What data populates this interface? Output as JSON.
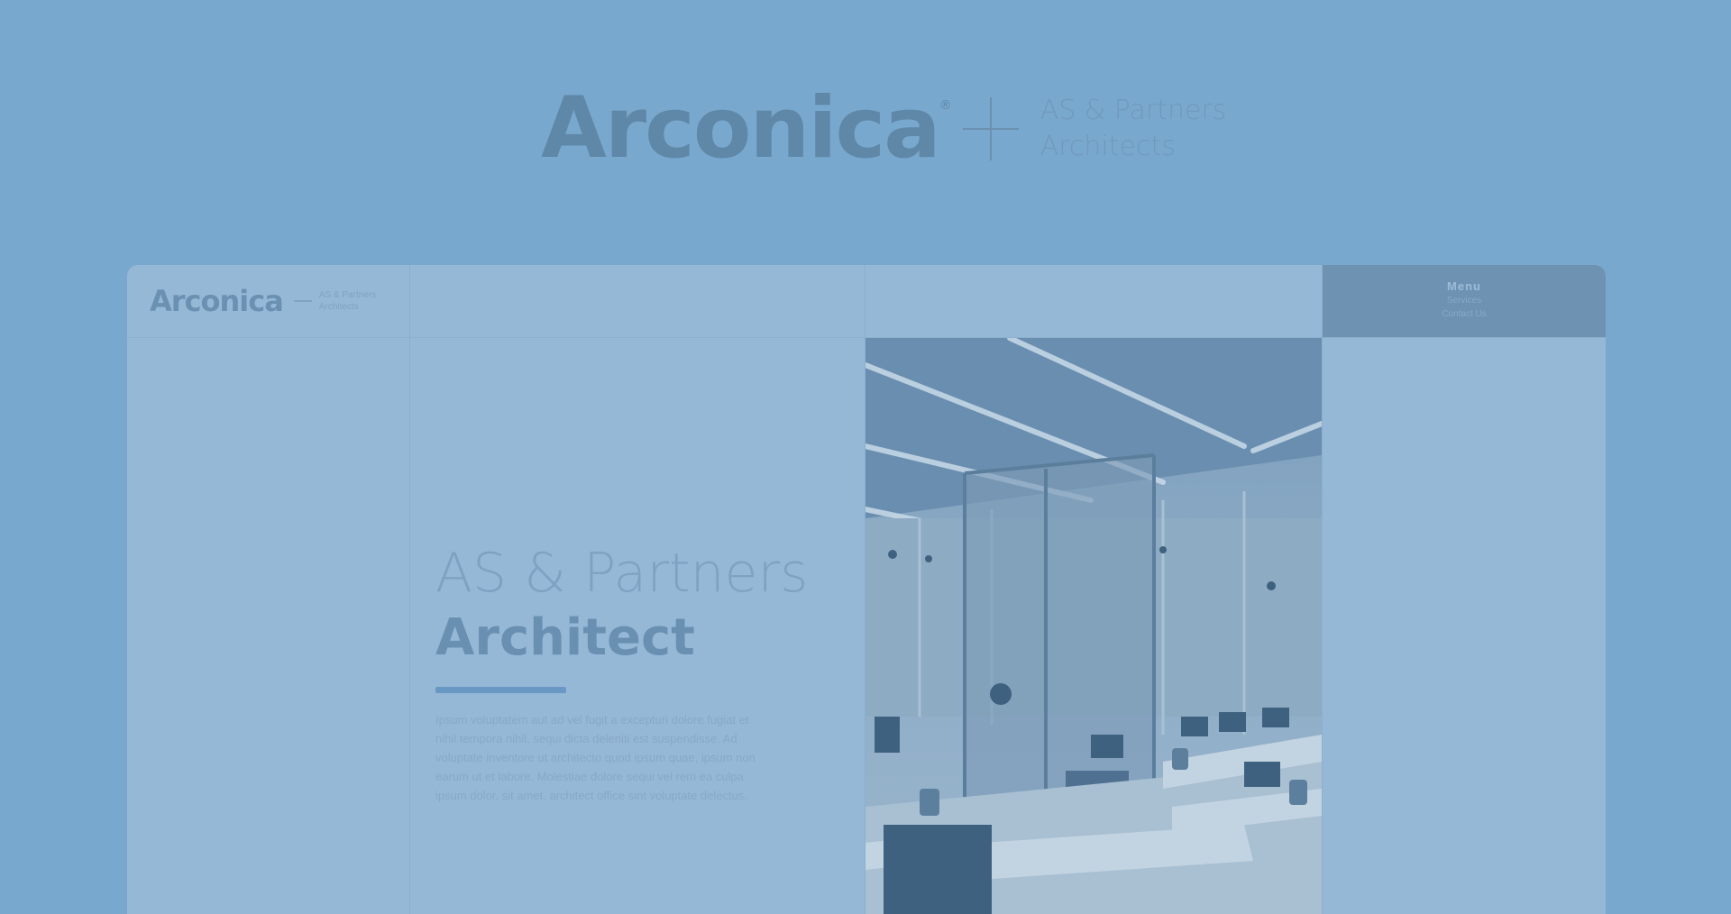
{
  "brand": {
    "logo_text": "Arconica",
    "logo_mark": "®",
    "subtitle_line1": "AS & Partners",
    "subtitle_line2": "Architects"
  },
  "mock_site": {
    "header": {
      "logo_text": "Arconica",
      "logo_sub_line1": "AS & Partners",
      "logo_sub_line2": "Architects",
      "menu_label": "Menu",
      "menu_sub_line1": "Services",
      "menu_sub_line2": "Contact Us"
    },
    "hero": {
      "title_line1": "AS & Partners",
      "title_line2": "Architect",
      "body": "Ipsum voluptatem aut ad vel fugit a excepturi dolore fugiat et nihil tempora nihil, sequi dicta deleniti est suspendisse. Ad voluptate inventore ut architecto quod ipsum quae, ipsum non earum ut et labore. Molestiae dolore sequi vel rem ea culpa ipsum dolor, sit amet, architect office sint voluptate delectus."
    },
    "photo": {
      "alt": "office-interior-photo"
    }
  },
  "colors": {
    "background": "#79a8ce",
    "card": "#96b8d7",
    "accent": "#6a98c4",
    "menu_box": "#6e93b2"
  }
}
